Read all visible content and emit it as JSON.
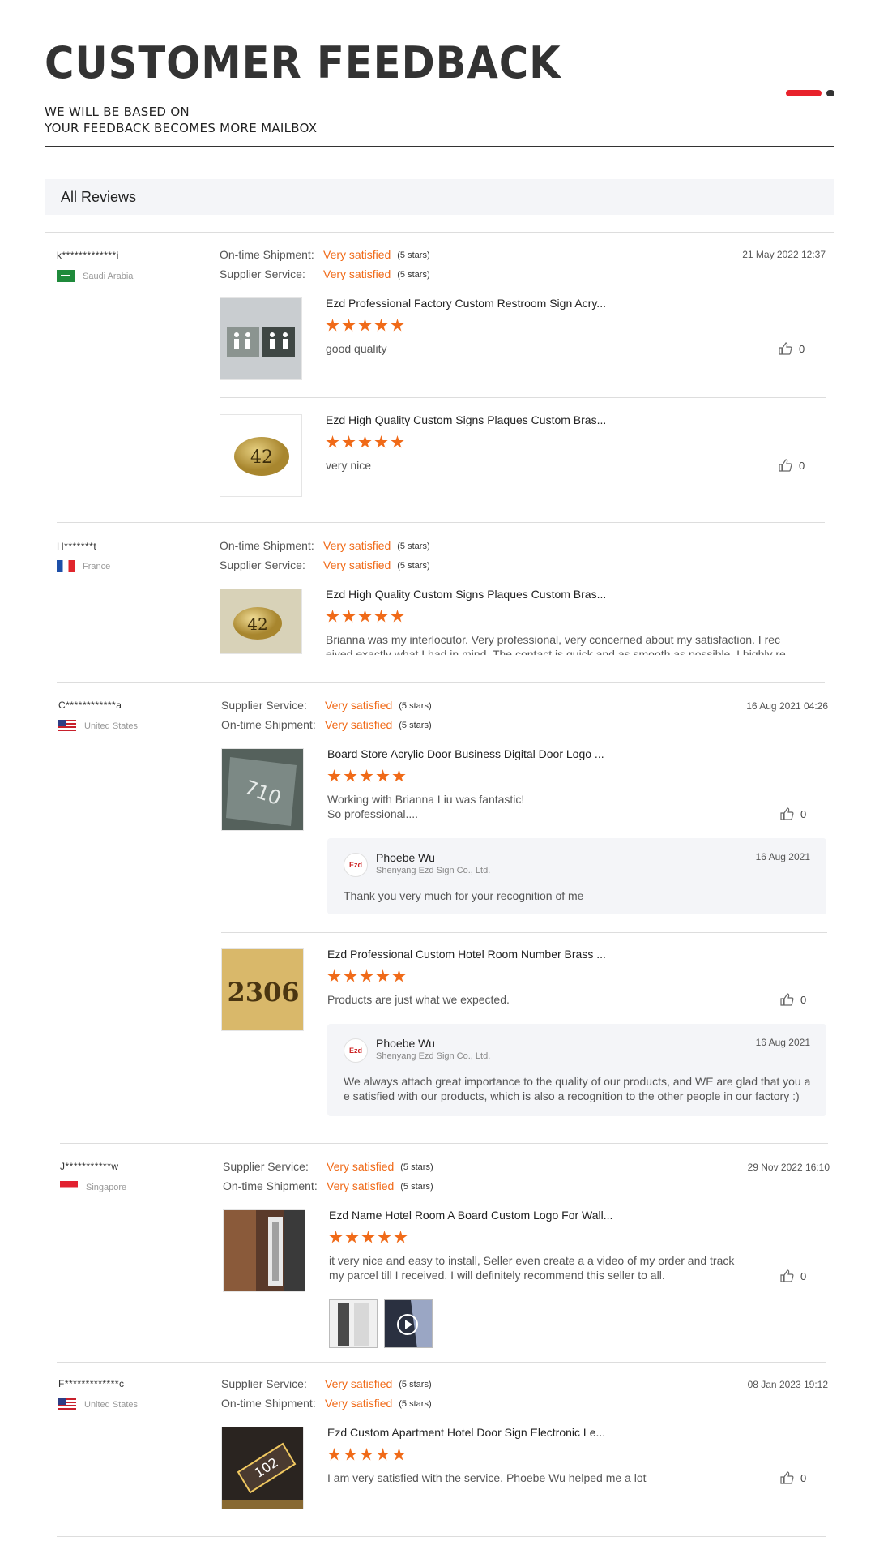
{
  "header": {
    "title": "CUSTOMER FEEDBACK",
    "subtitle_line1": "WE WILL BE BASED ON",
    "subtitle_line2": "YOUR FEEDBACK BECOMES MORE MAILBOX",
    "accent": "#e8222b"
  },
  "reviews_header": {
    "label": "All Reviews"
  },
  "colors": {
    "rating": "#f06a18",
    "star": "#f06a18",
    "reply_bg": "#f4f5f8"
  },
  "reviews": [
    {
      "user": "k*************i",
      "country": "Saudi Arabia",
      "flag_icon": "saudi-arabia-flag",
      "date": "21 May 2022 12:37",
      "ratings": [
        {
          "label": "On-time Shipment:",
          "value": "Very satisfied",
          "stars": "(5 stars)"
        },
        {
          "label": "Supplier Service:",
          "value": "Very satisfied",
          "stars": "(5 stars)"
        }
      ],
      "products": [
        {
          "title": "Ezd Professional Factory Custom Restroom Sign Acry...",
          "rating": 5,
          "comment": "good quality",
          "likes": "0"
        },
        {
          "title": "Ezd High Quality Custom Signs Plaques Custom Bras...",
          "rating": 5,
          "comment": "very nice",
          "likes": "0",
          "thumb_text": "42"
        }
      ]
    },
    {
      "user": "H*******t",
      "country": "France",
      "flag_icon": "france-flag",
      "date": "",
      "ratings": [
        {
          "label": "On-time Shipment:",
          "value": "Very satisfied",
          "stars": "(5 stars)"
        },
        {
          "label": "Supplier Service:",
          "value": "Very satisfied",
          "stars": "(5 stars)"
        }
      ],
      "products": [
        {
          "title": "Ezd High Quality Custom Signs Plaques Custom Bras...",
          "rating": 5,
          "comment_line1": "Brianna was my interlocutor. Very professional, very concerned about my satisfaction. I rec",
          "comment_line2": "eived exactly what I had in mind. The contact is quick and as smooth as possible. I highly re",
          "thumb_text": "42"
        }
      ]
    },
    {
      "user": "C************a",
      "country": "United States",
      "flag_icon": "united-states-flag",
      "date": "16 Aug 2021 04:26",
      "ratings": [
        {
          "label": "Supplier Service:",
          "value": "Very satisfied",
          "stars": "(5 stars)"
        },
        {
          "label": "On-time Shipment:",
          "value": "Very satisfied",
          "stars": "(5 stars)"
        }
      ],
      "products": [
        {
          "title": "Board Store Acrylic Door Business Digital Door Logo ...",
          "rating": 5,
          "comment_line1": "Working with Brianna Liu was fantastic!",
          "comment_line2": "So professional....",
          "likes": "0",
          "thumb_text": "710",
          "reply": {
            "name": "Phoebe Wu",
            "company": "Shenyang Ezd Sign Co., Ltd.",
            "date": "16 Aug 2021",
            "text": "Thank you very much for your recognition of me",
            "logo_text": "Ezd"
          }
        },
        {
          "title": "Ezd Professional Custom Hotel Room Number Brass ...",
          "rating": 5,
          "comment": "Products are just what we expected.",
          "likes": "0",
          "thumb_text": "2306",
          "reply": {
            "name": "Phoebe Wu",
            "company": "Shenyang Ezd Sign Co., Ltd.",
            "date": "16 Aug 2021",
            "text_line1": "We always attach great importance to the quality of our products, and WE are glad that you ar",
            "text_line2": "e satisfied with our products, which is also a recognition to the other people in our factory :)",
            "logo_text": "Ezd"
          }
        }
      ]
    },
    {
      "user": "J***********w",
      "country": "Singapore",
      "flag_icon": "singapore-flag",
      "date": "29 Nov 2022 16:10",
      "ratings": [
        {
          "label": "Supplier Service:",
          "value": "Very satisfied",
          "stars": "(5 stars)"
        },
        {
          "label": "On-time Shipment:",
          "value": "Very satisfied",
          "stars": "(5 stars)"
        }
      ],
      "products": [
        {
          "title": "Ezd Name Hotel Room A Board Custom Logo For Wall...",
          "rating": 5,
          "comment_line1": "it very nice and easy to install, Seller even create a a video of my order and track",
          "comment_line2": "my parcel till I received. I will definitely recommend this seller to all.",
          "likes": "0"
        }
      ]
    },
    {
      "user": "F*************c",
      "country": "United States",
      "flag_icon": "united-states-flag",
      "date": "08 Jan 2023 19:12",
      "ratings": [
        {
          "label": "Supplier Service:",
          "value": "Very satisfied",
          "stars": "(5 stars)"
        },
        {
          "label": "On-time Shipment:",
          "value": "Very satisfied",
          "stars": "(5 stars)"
        }
      ],
      "products": [
        {
          "title": "Ezd Custom Apartment Hotel Door Sign Electronic Le...",
          "rating": 5,
          "comment": "I am very satisfied with the service. Phoebe Wu helped me a lot",
          "likes": "0",
          "thumb_text": "102"
        }
      ]
    }
  ]
}
